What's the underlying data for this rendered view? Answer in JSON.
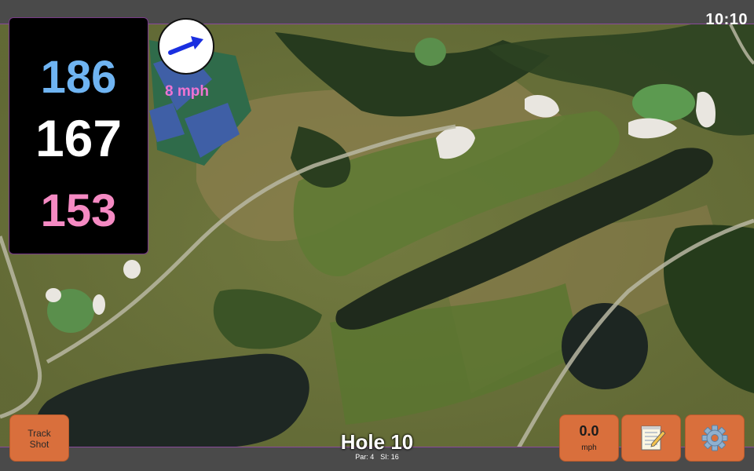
{
  "status": {
    "time": "10:10"
  },
  "distances": {
    "back": "186",
    "middle": "167",
    "front": "153",
    "colors": {
      "back": "#6fb4f2",
      "middle": "#ffffff",
      "front": "#f58ac3"
    }
  },
  "wind": {
    "arrow_icon": "wind-direction-arrow-icon",
    "speed_label": "8 mph"
  },
  "hole": {
    "title": "Hole 10",
    "par_label": "Par: 4",
    "si_label": "SI: 16"
  },
  "buttons": {
    "track_shot": "Track\nShot",
    "wind_value": "0.0",
    "wind_unit": "mph",
    "notes_icon": "notepad-icon",
    "settings_icon": "gear-icon"
  },
  "colors": {
    "button": "#d96f3c",
    "bar": "#4a4a4a",
    "panel": "#000000",
    "accent": "#8a4a9a"
  }
}
